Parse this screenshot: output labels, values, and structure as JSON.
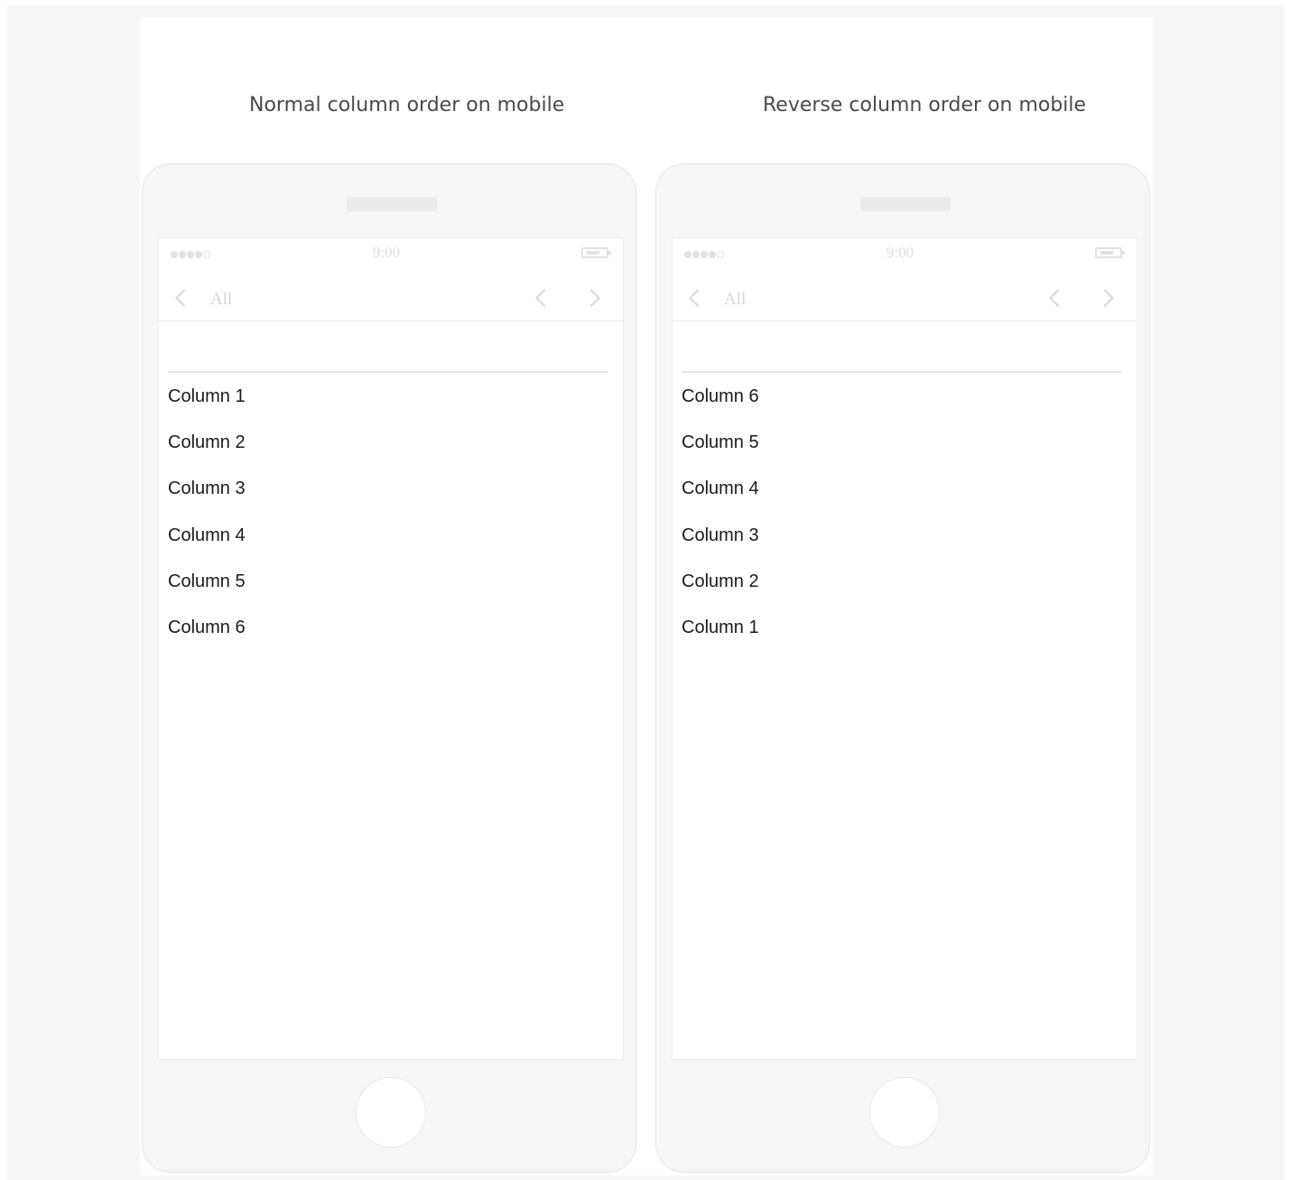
{
  "captions": {
    "normal": "Normal column order on mobile",
    "reverse": "Reverse column order on mobile"
  },
  "phone_ui": {
    "time": "9:00",
    "back_label": "All"
  },
  "normal_columns": [
    "Column 1",
    "Column 2",
    "Column 3",
    "Column 4",
    "Column 5",
    "Column 6"
  ],
  "reverse_columns": [
    "Column 6",
    "Column 5",
    "Column 4",
    "Column 3",
    "Column 2",
    "Column 1"
  ],
  "colors": {
    "page_background": "#f7f7f7",
    "card_background": "#ffffff",
    "phone_body": "#f6f6f6",
    "chrome_gray": "#e2e2e2",
    "text": "#1a1a1a"
  }
}
